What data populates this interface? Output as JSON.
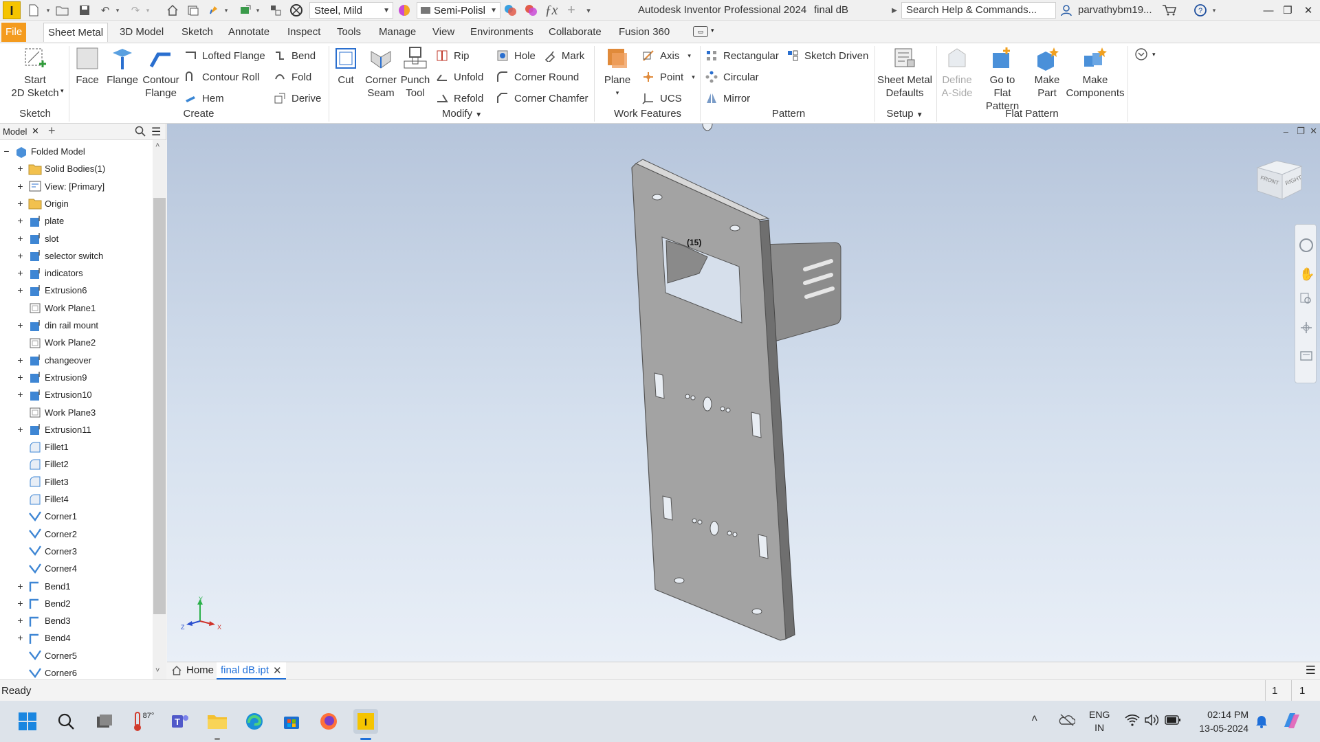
{
  "app": {
    "title": "Autodesk Inventor Professional 2024",
    "document": "final dB",
    "logo_letter": "I"
  },
  "quick_access": {
    "material": "Steel, Mild",
    "appearance": "Semi-Polisl",
    "search_placeholder": "Search Help & Commands...",
    "user": "parvathybm19..."
  },
  "tabs": [
    "File",
    "Sheet Metal",
    "3D Model",
    "Sketch",
    "Annotate",
    "Inspect",
    "Tools",
    "Manage",
    "View",
    "Environments",
    "Collaborate",
    "Fusion 360"
  ],
  "active_tab": "Sheet Metal",
  "ribbon": {
    "sketch": {
      "start_label1": "Start",
      "start_label2": "2D Sketch",
      "panel": "Sketch"
    },
    "create": {
      "face": "Face",
      "flange": "Flange",
      "contour_flange1": "Contour",
      "contour_flange2": "Flange",
      "lofted_flange": "Lofted Flange",
      "contour_roll": "Contour Roll",
      "hem": "Hem",
      "bend": "Bend",
      "fold": "Fold",
      "derive": "Derive",
      "panel": "Create"
    },
    "modify": {
      "cut": "Cut",
      "corner_seam1": "Corner",
      "corner_seam2": "Seam",
      "punch1": "Punch",
      "punch2": "Tool",
      "rip": "Rip",
      "unfold": "Unfold",
      "refold": "Refold",
      "hole": "Hole",
      "mark": "Mark",
      "corner_round": "Corner Round",
      "corner_chamfer": "Corner Chamfer",
      "panel": "Modify"
    },
    "work_features": {
      "plane": "Plane",
      "axis": "Axis",
      "point": "Point",
      "ucs": "UCS",
      "panel": "Work Features"
    },
    "pattern": {
      "rectangular": "Rectangular",
      "circular": "Circular",
      "mirror": "Mirror",
      "sketch_driven": "Sketch Driven",
      "panel": "Pattern"
    },
    "setup": {
      "defaults1": "Sheet Metal",
      "defaults2": "Defaults",
      "panel": "Setup"
    },
    "flat_pattern": {
      "define1": "Define",
      "define2": "A-Side",
      "goto1": "Go to",
      "goto2": "Flat Pattern",
      "makepart1": "Make",
      "makepart2": "Part",
      "makecomp1": "Make",
      "makecomp2": "Components",
      "panel": "Flat Pattern"
    }
  },
  "browser": {
    "tab": "Model",
    "items": [
      {
        "label": "Folded Model",
        "level": 0,
        "exp": "−",
        "icon": "part"
      },
      {
        "label": "Solid Bodies(1)",
        "level": 1,
        "exp": "+",
        "icon": "folder"
      },
      {
        "label": "View: [Primary]",
        "level": 1,
        "exp": "+",
        "icon": "view"
      },
      {
        "label": "Origin",
        "level": 1,
        "exp": "+",
        "icon": "folder"
      },
      {
        "label": "plate",
        "level": 1,
        "exp": "+",
        "icon": "feature"
      },
      {
        "label": "slot",
        "level": 1,
        "exp": "+",
        "icon": "feature"
      },
      {
        "label": "selector switch",
        "level": 1,
        "exp": "+",
        "icon": "feature"
      },
      {
        "label": "indicators",
        "level": 1,
        "exp": "+",
        "icon": "feature"
      },
      {
        "label": "Extrusion6",
        "level": 1,
        "exp": "+",
        "icon": "feature"
      },
      {
        "label": "Work Plane1",
        "level": 1,
        "exp": "",
        "icon": "plane"
      },
      {
        "label": "din rail mount",
        "level": 1,
        "exp": "+",
        "icon": "feature"
      },
      {
        "label": "Work Plane2",
        "level": 1,
        "exp": "",
        "icon": "plane"
      },
      {
        "label": "changeover",
        "level": 1,
        "exp": "+",
        "icon": "feature"
      },
      {
        "label": "Extrusion9",
        "level": 1,
        "exp": "+",
        "icon": "feature"
      },
      {
        "label": "Extrusion10",
        "level": 1,
        "exp": "+",
        "icon": "feature"
      },
      {
        "label": "Work Plane3",
        "level": 1,
        "exp": "",
        "icon": "plane"
      },
      {
        "label": "Extrusion11",
        "level": 1,
        "exp": "+",
        "icon": "feature"
      },
      {
        "label": "Fillet1",
        "level": 1,
        "exp": "",
        "icon": "fillet"
      },
      {
        "label": "Fillet2",
        "level": 1,
        "exp": "",
        "icon": "fillet"
      },
      {
        "label": "Fillet3",
        "level": 1,
        "exp": "",
        "icon": "fillet"
      },
      {
        "label": "Fillet4",
        "level": 1,
        "exp": "",
        "icon": "fillet"
      },
      {
        "label": "Corner1",
        "level": 1,
        "exp": "",
        "icon": "corner"
      },
      {
        "label": "Corner2",
        "level": 1,
        "exp": "",
        "icon": "corner"
      },
      {
        "label": "Corner3",
        "level": 1,
        "exp": "",
        "icon": "corner"
      },
      {
        "label": "Corner4",
        "level": 1,
        "exp": "",
        "icon": "corner"
      },
      {
        "label": "Bend1",
        "level": 1,
        "exp": "+",
        "icon": "bend"
      },
      {
        "label": "Bend2",
        "level": 1,
        "exp": "+",
        "icon": "bend"
      },
      {
        "label": "Bend3",
        "level": 1,
        "exp": "+",
        "icon": "bend"
      },
      {
        "label": "Bend4",
        "level": 1,
        "exp": "+",
        "icon": "bend"
      },
      {
        "label": "Corner5",
        "level": 1,
        "exp": "",
        "icon": "corner"
      },
      {
        "label": "Corner6",
        "level": 1,
        "exp": "",
        "icon": "corner"
      }
    ]
  },
  "viewport": {
    "annotation": "(15)",
    "viewcube_front": "FRONT",
    "viewcube_right": "RIGHT",
    "axis_x": "X",
    "axis_y": "Y",
    "axis_z": "Z"
  },
  "doc_tabs": {
    "home": "Home",
    "file": "final dB.ipt"
  },
  "status": {
    "text": "Ready",
    "count1": "1",
    "count2": "1"
  },
  "taskbar": {
    "temp": "87°",
    "lang1": "ENG",
    "lang2": "IN",
    "time": "02:14 PM",
    "date": "13-05-2024"
  },
  "colors": {
    "file_tab": "#f49b1e",
    "accent": "#1e6fd9",
    "viewport_top": "#b6c5db",
    "viewport_bottom": "#e9eff7"
  }
}
